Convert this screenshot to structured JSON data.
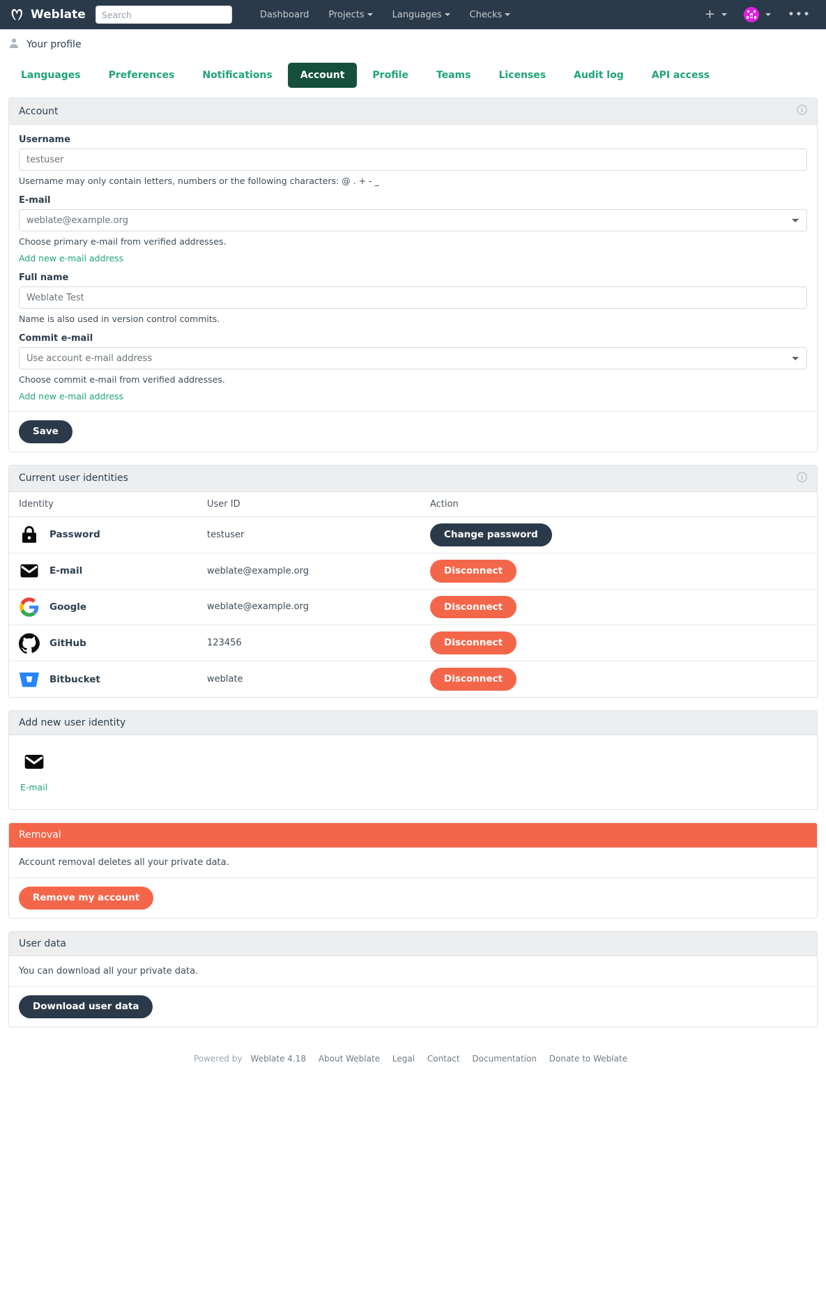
{
  "navbar": {
    "brand": "Weblate",
    "brand_logo_icon": "weblate-logo-icon",
    "search_placeholder": "Search",
    "search_value": "",
    "links": [
      {
        "label": "Dashboard",
        "has_caret": false
      },
      {
        "label": "Projects",
        "has_caret": true
      },
      {
        "label": "Languages",
        "has_caret": true
      },
      {
        "label": "Checks",
        "has_caret": true
      }
    ],
    "add_icon": "plus-icon",
    "avatar_icon": "user-avatar-identicon",
    "menu_icon": "ellipsis-icon",
    "avatar_color": "#e21fe2"
  },
  "page": {
    "profile_title": "Your profile",
    "profile_icon": "person-icon"
  },
  "tabs": [
    {
      "label": "Languages",
      "active": false
    },
    {
      "label": "Preferences",
      "active": false
    },
    {
      "label": "Notifications",
      "active": false
    },
    {
      "label": "Account",
      "active": true
    },
    {
      "label": "Profile",
      "active": false
    },
    {
      "label": "Teams",
      "active": false
    },
    {
      "label": "Licenses",
      "active": false
    },
    {
      "label": "Audit log",
      "active": false
    },
    {
      "label": "API access",
      "active": false
    }
  ],
  "account_panel": {
    "title": "Account",
    "info_icon": "info-circle-icon",
    "username": {
      "label": "Username",
      "value": "testuser",
      "help": "Username may only contain letters, numbers or the following characters: @ . + - _"
    },
    "email": {
      "label": "E-mail",
      "value": "weblate@example.org",
      "help": "Choose primary e-mail from verified addresses.",
      "add_link": "Add new e-mail address"
    },
    "full_name": {
      "label": "Full name",
      "value": "Weblate Test",
      "help": "Name is also used in version control commits."
    },
    "commit_email": {
      "label": "Commit e-mail",
      "value": "Use account e-mail address",
      "help": "Choose commit e-mail from verified addresses.",
      "add_link": "Add new e-mail address"
    },
    "save_label": "Save"
  },
  "identities_panel": {
    "title": "Current user identities",
    "info_icon": "info-circle-icon",
    "columns": [
      "Identity",
      "User ID",
      "Action"
    ],
    "rows": [
      {
        "icon": "lock-icon",
        "name": "Password",
        "user_id": "testuser",
        "action_label": "Change password",
        "action_style": "dark"
      },
      {
        "icon": "envelope-icon",
        "name": "E-mail",
        "user_id": "weblate@example.org",
        "action_label": "Disconnect",
        "action_style": "danger"
      },
      {
        "icon": "google-icon",
        "name": "Google",
        "user_id": "weblate@example.org",
        "action_label": "Disconnect",
        "action_style": "danger"
      },
      {
        "icon": "github-icon",
        "name": "GitHub",
        "user_id": "123456",
        "action_label": "Disconnect",
        "action_style": "danger"
      },
      {
        "icon": "bitbucket-icon",
        "name": "Bitbucket",
        "user_id": "weblate",
        "action_label": "Disconnect",
        "action_style": "danger"
      }
    ]
  },
  "add_identity_panel": {
    "title": "Add new user identity",
    "options": [
      {
        "icon": "envelope-icon",
        "label": "E-mail"
      }
    ]
  },
  "removal_panel": {
    "title": "Removal",
    "body": "Account removal deletes all your private data.",
    "button_label": "Remove my account"
  },
  "userdata_panel": {
    "title": "User data",
    "body": "You can download all your private data.",
    "button_label": "Download user data"
  },
  "footer": {
    "powered_by": "Powered by",
    "version": "Weblate 4.18",
    "links": [
      "About Weblate",
      "Legal",
      "Contact",
      "Documentation",
      "Donate to Weblate"
    ]
  },
  "colors": {
    "navbar_bg": "#2b3a4a",
    "accent_green": "#1fa37a",
    "active_tab_bg": "#15503c",
    "danger": "#f4664a",
    "panel_head_bg": "#eceef0"
  }
}
